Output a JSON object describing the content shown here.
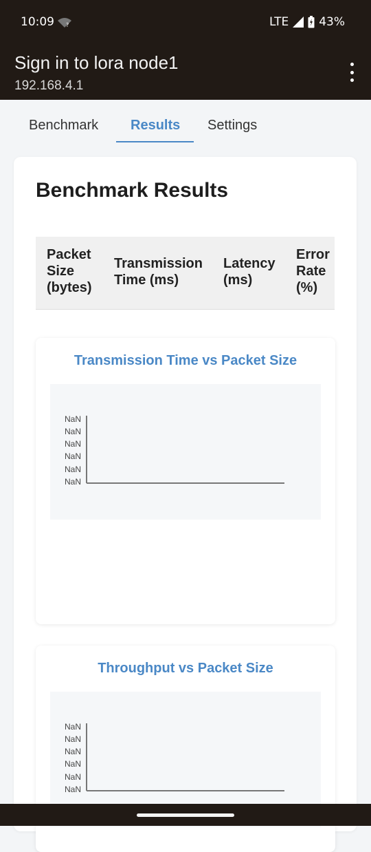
{
  "status_bar": {
    "time": "10:09",
    "network": "LTE",
    "battery": "43%"
  },
  "app_bar": {
    "title": "Sign in to lora node1",
    "subtitle": "192.168.4.1"
  },
  "tabs": [
    {
      "label": "Benchmark"
    },
    {
      "label": "Results",
      "active": true
    },
    {
      "label": "Settings"
    }
  ],
  "results": {
    "heading": "Benchmark Results",
    "columns": [
      {
        "line1": "Packet",
        "line2": "Size",
        "line3": "(bytes)"
      },
      {
        "line1": "Transmission",
        "line2": "Time (ms)"
      },
      {
        "line1": "Latency",
        "line2": "(ms)"
      },
      {
        "line1": "Error",
        "line2": "Rate",
        "line3": "(%)"
      }
    ]
  },
  "charts": [
    {
      "title": "Transmission Time vs Packet Size",
      "y_ticks": [
        "NaN",
        "NaN",
        "NaN",
        "NaN",
        "NaN",
        "NaN"
      ]
    },
    {
      "title": "Throughput vs Packet Size",
      "y_ticks": [
        "NaN",
        "NaN",
        "NaN",
        "NaN",
        "NaN",
        "NaN"
      ]
    }
  ],
  "colors": {
    "accent": "#4a88c6",
    "bar": "#211a15",
    "background": "#f3f5f7"
  }
}
